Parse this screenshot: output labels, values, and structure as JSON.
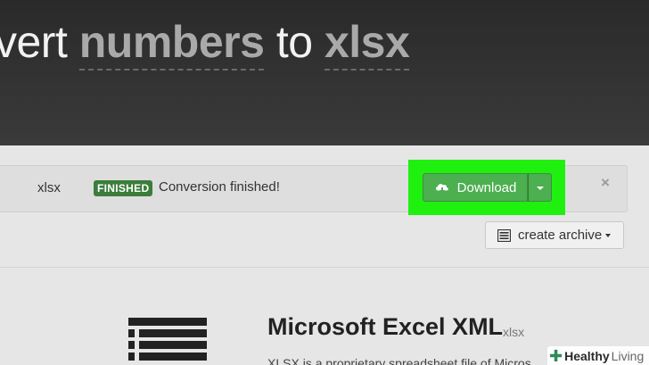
{
  "hero": {
    "prefix": "vert",
    "from_format": "numbers",
    "connector": "to",
    "to_format": "xlsx"
  },
  "file": {
    "extension": "xlsx",
    "status_badge": "FINISHED",
    "status_text": "Conversion finished!"
  },
  "actions": {
    "download_label": "Download",
    "download_icon": "cloud-download-icon",
    "close_symbol": "×",
    "archive_label": "create archive",
    "archive_icon": "archive-icon"
  },
  "format_info": {
    "title": "Microsoft Excel XML",
    "extension": "xlsx",
    "description": "XLSX is a proprietary spreadsheet file of Micros"
  },
  "watermark": {
    "part1": "Healthy",
    "part2": "Living"
  },
  "colors": {
    "hero_bg": "#333333",
    "badge": "#3b7d3b",
    "download_button": "#4caf50",
    "highlight": "#1ff00f"
  }
}
